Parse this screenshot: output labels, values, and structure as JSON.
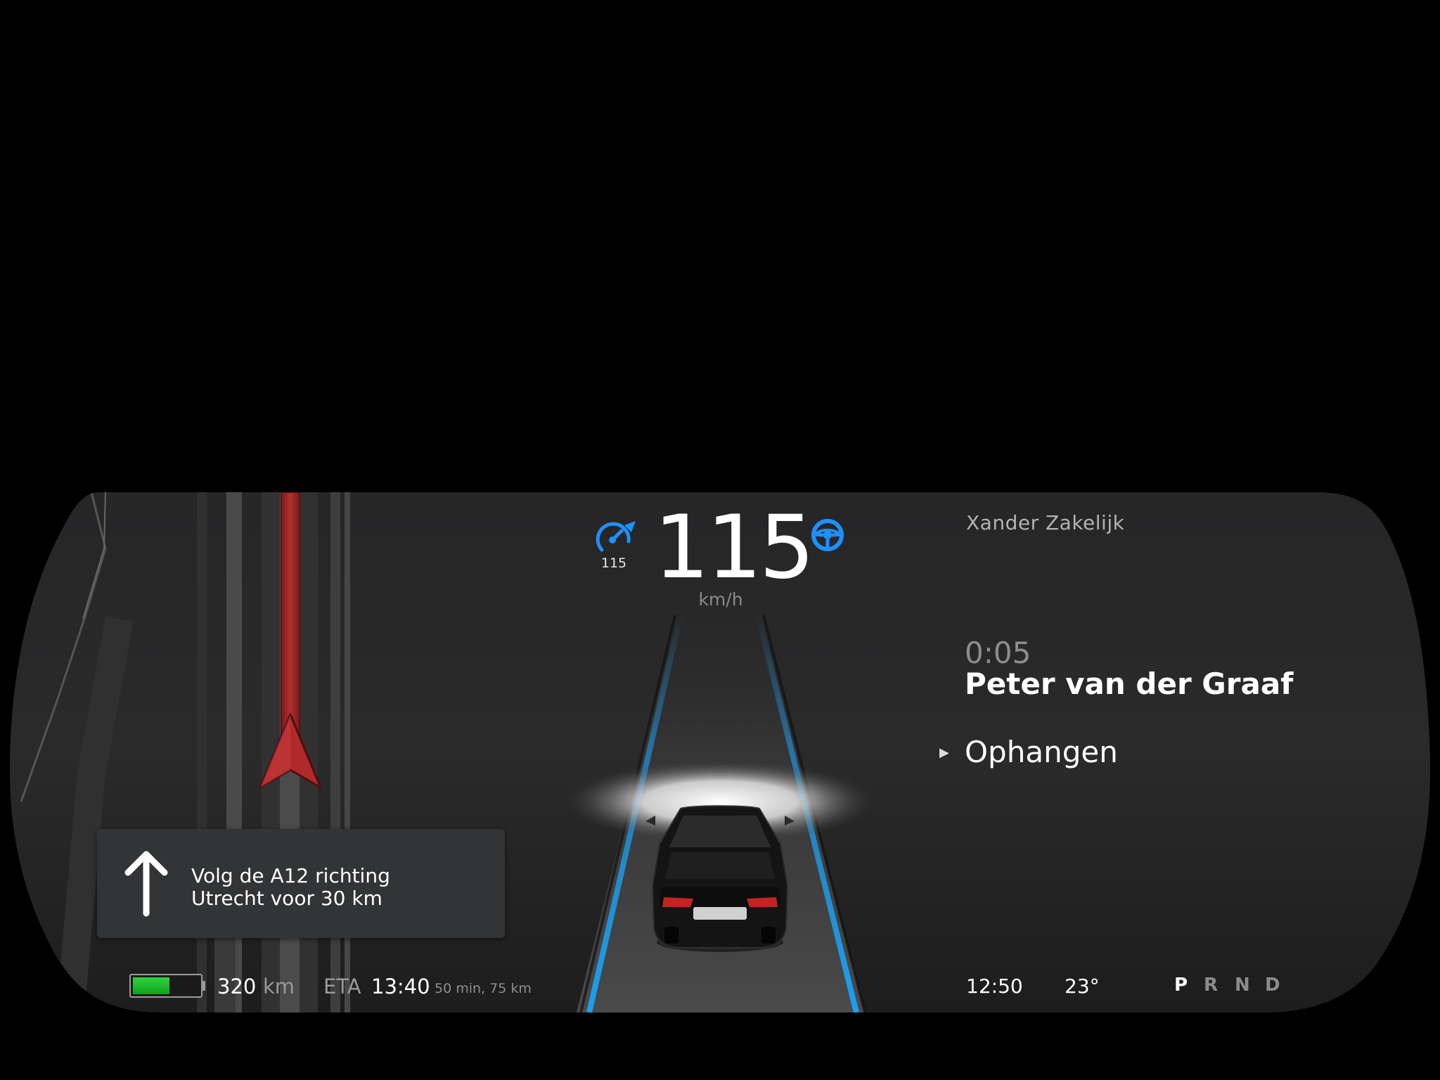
{
  "speedometer": {
    "speed": "115",
    "unit": "km/h",
    "cruise_set_speed": "115",
    "cruise_icon": "cruise-control-icon",
    "autosteer_icon": "steering-wheel-icon",
    "accent_color": "#1e90ff"
  },
  "driver_profile": "Xander Zakelijk",
  "call": {
    "duration": "0:05",
    "caller": "Peter van der Graaf",
    "action_label": "Ophangen",
    "action_icon": "play-triangle-icon"
  },
  "navigation": {
    "maneuver_icon": "arrow-up-icon",
    "instruction_line_1": "Volg de A12 richting",
    "instruction_line_2": "Utrecht voor 30 km",
    "route_color": "#a8282a"
  },
  "status": {
    "battery_level": 0.55,
    "battery_color": "#22c12d",
    "range_value": "320",
    "range_unit": "km",
    "eta_label": "ETA",
    "eta_time": "13:40",
    "eta_detail": "50 min, 75 km",
    "clock": "12:50",
    "temperature": "23°"
  },
  "gears": {
    "p": "P",
    "r": "R",
    "n": "N",
    "d": "D",
    "selected": "P"
  },
  "lane_color": "#1aa0f0"
}
